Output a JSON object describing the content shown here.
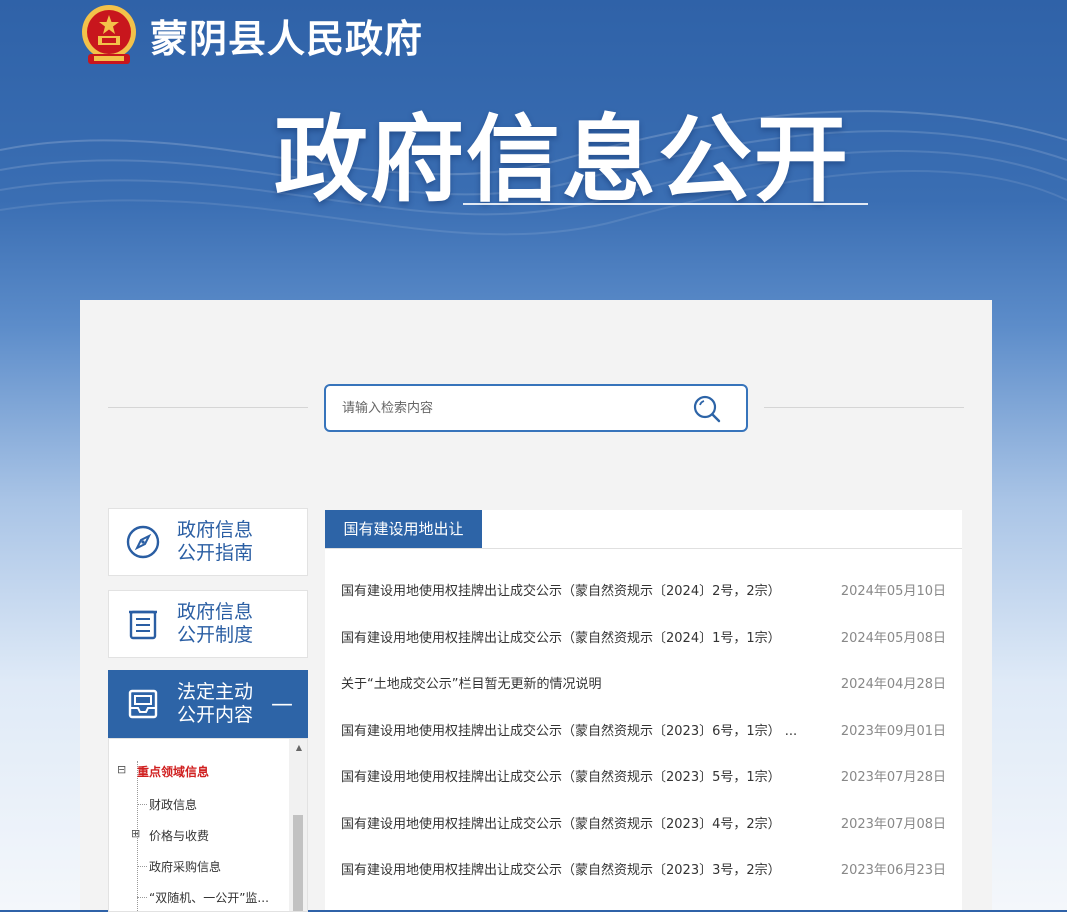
{
  "header": {
    "site_name": "蒙阴县人民政府",
    "hero_title": "政府信息公开"
  },
  "colors": {
    "primary": "#2d64a7",
    "accent_red": "#d02020",
    "emblem_red": "#c8161d",
    "emblem_gold": "#f3c24a"
  },
  "search": {
    "placeholder": "请输入检索内容",
    "value": ""
  },
  "sidebar": {
    "cards": [
      {
        "label": "政府信息\n公开指南",
        "icon": "compass-icon"
      },
      {
        "label": "政府信息\n公开制度",
        "icon": "document-list-icon"
      },
      {
        "label": "法定主动\n公开内容",
        "icon": "inbox-icon",
        "collapse": "—"
      }
    ],
    "tree": {
      "root_toggle": "⊟",
      "root": "重点领域信息",
      "items": [
        {
          "label": "财政信息",
          "toggle": ""
        },
        {
          "label": "价格与收费",
          "toggle": "⊞"
        },
        {
          "label": "政府采购信息",
          "toggle": ""
        },
        {
          "label": "“双随机、一公开”监...",
          "toggle": ""
        }
      ]
    }
  },
  "main": {
    "tab": "国有建设用地出让",
    "items": [
      {
        "title": "国有建设用地使用权挂牌出让成交公示（蒙自然资规示〔2024〕2号，2宗）",
        "date": "2024年05月10日"
      },
      {
        "title": "国有建设用地使用权挂牌出让成交公示（蒙自然资规示〔2024〕1号，1宗）",
        "date": "2024年05月08日"
      },
      {
        "title": "关于“土地成交公示”栏目暂无更新的情况说明",
        "date": "2024年04月28日"
      },
      {
        "title": "国有建设用地使用权挂牌出让成交公示（蒙自然资规示〔2023〕6号，1宗） ...",
        "date": "2023年09月01日"
      },
      {
        "title": "国有建设用地使用权挂牌出让成交公示（蒙自然资规示〔2023〕5号，1宗）",
        "date": "2023年07月28日"
      },
      {
        "title": "国有建设用地使用权挂牌出让成交公示（蒙自然资规示〔2023〕4号，2宗）",
        "date": "2023年07月08日"
      },
      {
        "title": "国有建设用地使用权挂牌出让成交公示（蒙自然资规示〔2023〕3号，2宗）",
        "date": "2023年06月23日"
      }
    ]
  }
}
